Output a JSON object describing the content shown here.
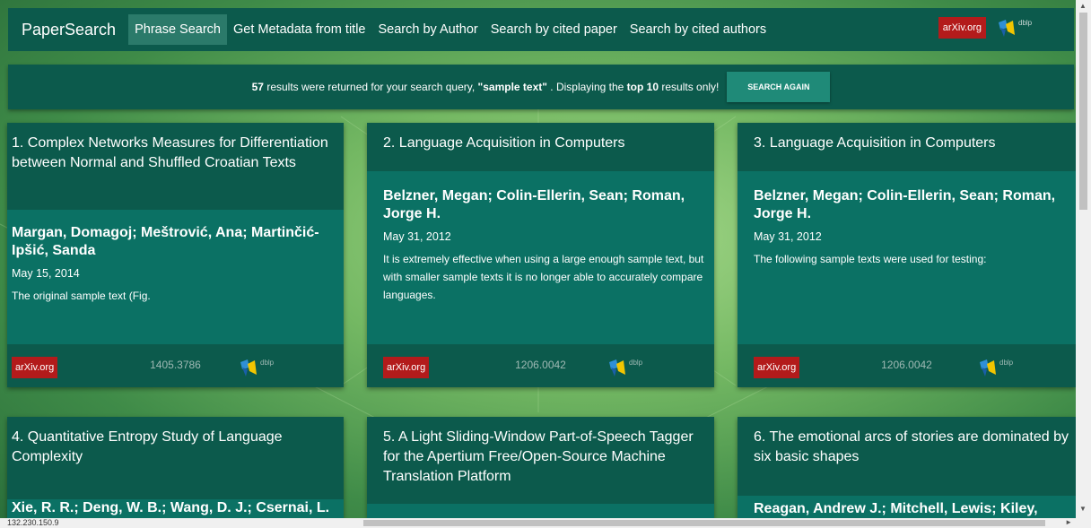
{
  "navbar": {
    "brand": "PaperSearch",
    "items": [
      {
        "label": "Phrase Search",
        "active": true
      },
      {
        "label": "Get Metadata from title",
        "active": false
      },
      {
        "label": "Search by Author",
        "active": false
      },
      {
        "label": "Search by cited paper",
        "active": false
      },
      {
        "label": "Search by cited authors",
        "active": false
      }
    ],
    "arxiv_label": "arXiv.org",
    "dblp_label": "dblp"
  },
  "banner": {
    "count": "57",
    "text_pre": " results were returned for your search query, ",
    "query": "\"sample text\"",
    "text_mid": " . Displaying the ",
    "top": "top 10",
    "text_post": " results only!",
    "button_label": "SEARCH AGAIN"
  },
  "cards": [
    {
      "title": "1. Complex Networks Measures for Differentiation between Normal and Shuffled Croatian Texts",
      "authors": "Margan, Domagoj; Meštrović, Ana; Martinčić-Ipšić, Sanda",
      "date": "May 15, 2014",
      "snippet": "The original sample text (Fig.",
      "arxiv_label": "arXiv.org",
      "arxiv_id": "1405.3786",
      "dblp_label": "dblp"
    },
    {
      "title": "2. Language Acquisition in Computers",
      "authors": "Belzner, Megan; Colin-Ellerin, Sean; Roman, Jorge H.",
      "date": "May 31, 2012",
      "snippet": "It is extremely effective when using a large enough sample text, but with smaller sample texts it is no longer able to accurately compare languages.",
      "arxiv_label": "arXiv.org",
      "arxiv_id": "1206.0042",
      "dblp_label": "dblp"
    },
    {
      "title": "3. Language Acquisition in Computers",
      "authors": "Belzner, Megan; Colin-Ellerin, Sean; Roman, Jorge H.",
      "date": "May 31, 2012",
      "snippet": "The following sample texts were used for testing:",
      "arxiv_label": "arXiv.org",
      "arxiv_id": "1206.0042",
      "dblp_label": "dblp"
    },
    {
      "title": "4. Quantitative Entropy Study of Language Complexity",
      "authors": "Xie, R. R.; Deng, W. B.; Wang, D. J.; Csernai, L."
    },
    {
      "title": "5. A Light Sliding-Window Part-of-Speech Tagger for the Apertium Free/Open-Source Machine Translation Platform"
    },
    {
      "title": "6. The emotional arcs of stories are dominated by six basic shapes",
      "authors": "Reagan, Andrew J.; Mitchell, Lewis; Kiley,"
    }
  ],
  "status_bar": {
    "text": "132.230.150.9"
  },
  "colors": {
    "header_green": "#0c5a4c",
    "body_green": "#0b7164",
    "arxiv_red": "#b31b1b"
  }
}
